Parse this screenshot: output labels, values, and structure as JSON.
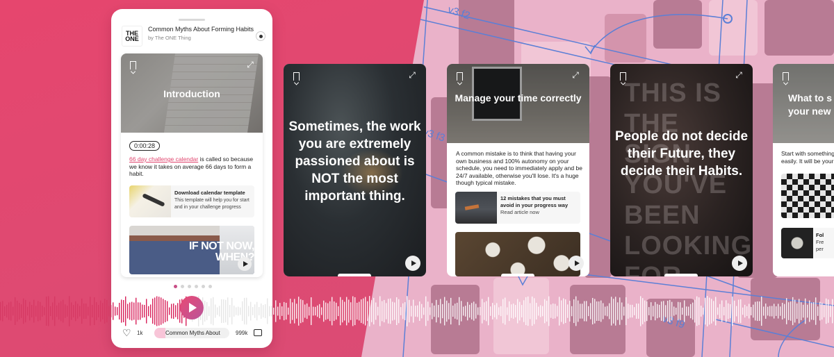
{
  "colors": {
    "background": "#e6466e",
    "accent": "#e0456e",
    "accent_secondary": "#b9559a",
    "board": "#eab2c9",
    "connector": "#5b7fd6"
  },
  "board_labels": [
    "v3 f2",
    "v3 f3",
    "v3 f9"
  ],
  "phone": {
    "podcast": {
      "logo_text": "THE ONE",
      "title": "Common Myths About Forming Habits",
      "author": "by The ONE Thing"
    },
    "story": {
      "title": "Introduction",
      "icons": [
        "bookmark-icon",
        "expand-icon"
      ],
      "timer": "0:00:28",
      "body_link": "66 day challenge calendar",
      "body_rest": " is called so because we know it takes on average 66 days to form a habit.",
      "download": {
        "title": "Download calendar template",
        "description": "This template will help you for start and in your challenge progress"
      },
      "video_text": "IF NOT NOW, WHEN?"
    },
    "pagination": {
      "total": 6,
      "active": 0
    },
    "player": {
      "likes": "1k",
      "episode_label": "Common Myths About",
      "progress": 0.1,
      "comments": "999k",
      "icons": [
        "heart-icon",
        "play-icon",
        "comment-icon"
      ]
    }
  },
  "cards": [
    {
      "quote": "Sometimes, the work you are extremely passioned about is NOT the most important thing."
    },
    {
      "title": "Manage your time correctly",
      "text": "A common mistake is to think that having your own business and 100% autonomy on your schedule, you need to immediately apply and be 24/7 available, otherwise you'll lose. It's a huge though typical mistake.",
      "article_title": "12 mistakes that you must avoid in your progress way",
      "article_link": "Read article now"
    },
    {
      "quote": "People do not decide their Future, they decide their Habits.",
      "background_text": "THIS IS THE SIGN YOU'VE BEEN LOOKING FOR"
    },
    {
      "title": "What to s... your new...",
      "title_line1": "What to s",
      "title_line2": "your new",
      "text_line1": "Start with something",
      "text_line2": "easily. It will be your f",
      "item_title": "Fol",
      "item_line1": "Fre",
      "item_line2": "per"
    }
  ]
}
